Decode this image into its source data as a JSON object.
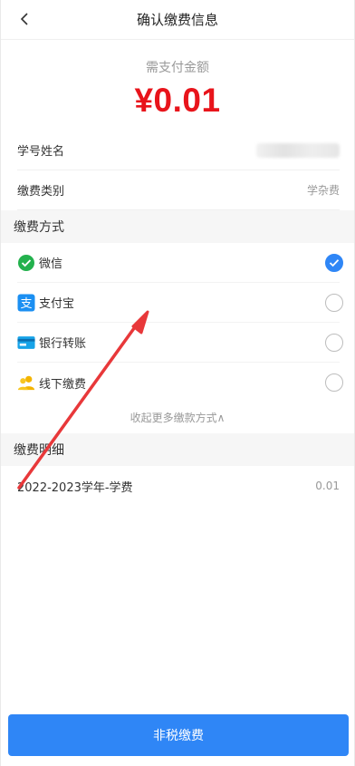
{
  "header": {
    "title": "确认缴费信息"
  },
  "amount": {
    "label": "需支付金额",
    "value": "¥0.01"
  },
  "info": {
    "student_label": "学号姓名",
    "fee_type_label": "缴费类别",
    "fee_type_value": "学杂费"
  },
  "payment": {
    "section_title": "缴费方式",
    "methods": [
      {
        "label": "微信",
        "icon": "wechat-icon",
        "selected": true
      },
      {
        "label": "支付宝",
        "icon": "alipay-icon",
        "selected": false
      },
      {
        "label": "银行转账",
        "icon": "bank-card-icon",
        "selected": false
      },
      {
        "label": "线下缴费",
        "icon": "person-icon",
        "selected": false
      }
    ],
    "collapse_label": "收起更多缴款方式∧"
  },
  "details": {
    "section_title": "缴费明细",
    "items": [
      {
        "name": "2022-2023学年-学费",
        "amount": "0.01"
      }
    ]
  },
  "footer": {
    "button_label": "非税缴费"
  },
  "colors": {
    "accent": "#2f86f6",
    "amount": "#e8141b",
    "annotation_arrow": "#e8383a"
  }
}
